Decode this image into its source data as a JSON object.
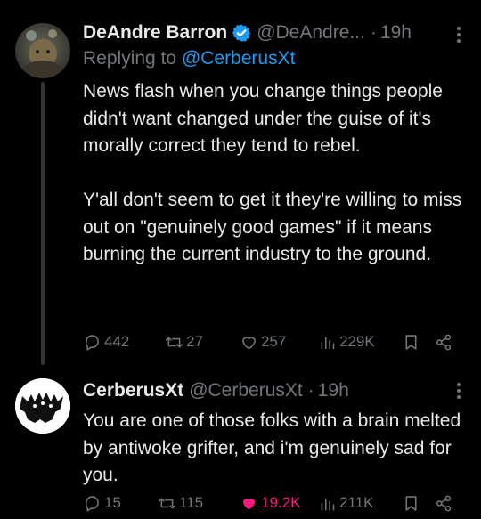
{
  "tweets": [
    {
      "author_name": "DeAndre Barron",
      "handle": "@DeAndre...",
      "dot": "·",
      "time": "19h",
      "reply_prefix": "Replying to",
      "reply_mention": "@CerberusXt",
      "paragraphs": [
        "News flash when you change things people didn't want changed under the guise of it's morally correct they tend to rebel.",
        "Y'all don't seem to get it they're willing to miss out on \"genuinely good games\" if it means burning the current industry to the ground."
      ],
      "replies": "442",
      "reposts": "27",
      "likes": "257",
      "views": "229K",
      "liked": false,
      "verified": true
    },
    {
      "author_name": "CerberusXt",
      "handle": "@CerberusXt",
      "dot": "·",
      "time": "19h",
      "paragraphs": [
        "You are one of those folks with a brain melted by antiwoke grifter, and i'm genuinely sad for you."
      ],
      "replies": "15",
      "reposts": "115",
      "likes": "19.2K",
      "views": "211K",
      "liked": true,
      "verified": false
    }
  ],
  "colors": {
    "background": "#000000",
    "text": "#e7e9ea",
    "muted": "#71767b",
    "link": "#1d9bf0",
    "like": "#f91880",
    "verified": "#1d9bf0"
  },
  "icons": [
    "verified-badge-icon",
    "more-icon",
    "reply-icon",
    "repost-icon",
    "like-icon",
    "views-icon",
    "bookmark-icon",
    "share-icon"
  ]
}
